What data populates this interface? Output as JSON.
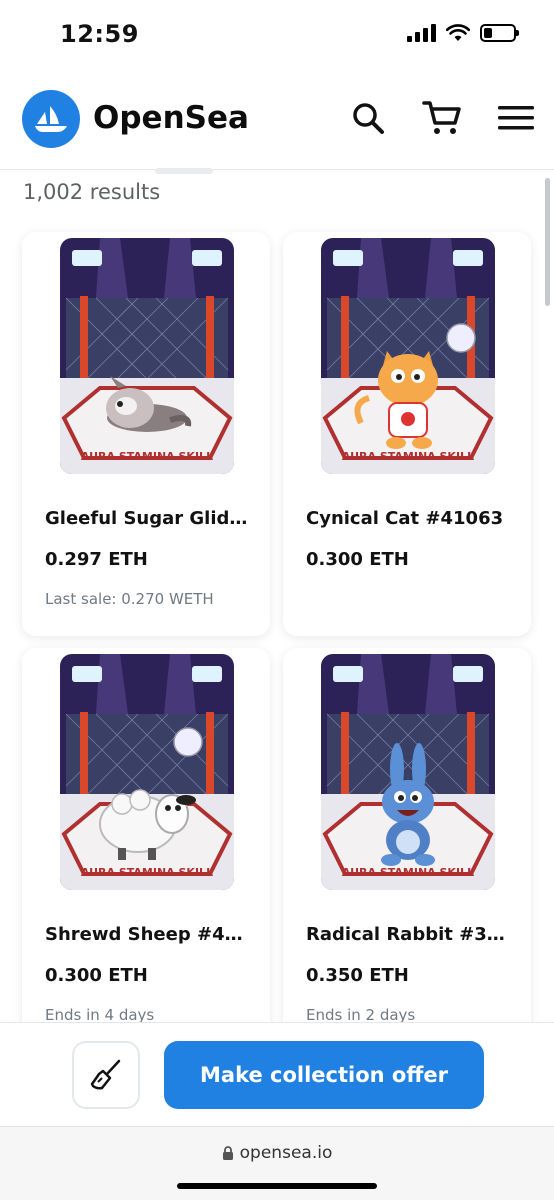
{
  "status_bar": {
    "time": "12:59",
    "battery_level": 0.3
  },
  "header": {
    "brand": "OpenSea",
    "brand_color": "#2081e2",
    "icons": [
      "opensea-logo-icon",
      "search-icon",
      "cart-icon",
      "menu-icon"
    ]
  },
  "results": {
    "count_text": "1,002 results"
  },
  "cards": [
    {
      "name": "Gleeful Sugar Glid…",
      "price": "0.297 ETH",
      "subtext": "Last sale: 0.270 WETH",
      "character": "sugar-glider"
    },
    {
      "name": "Cynical Cat #41063",
      "price": "0.300 ETH",
      "subtext": "",
      "character": "cat"
    },
    {
      "name": "Shrewd Sheep #4…",
      "price": "0.300 ETH",
      "subtext": "Ends in 4 days",
      "character": "sheep"
    },
    {
      "name": "Radical Rabbit #3…",
      "price": "0.350 ETH",
      "subtext": "Ends in 2 days",
      "character": "rabbit"
    }
  ],
  "card_art_text": "AURA STAMINA SKILL",
  "bottom_bar": {
    "offer_label": "Make collection offer",
    "sweep_icon": "broom-icon"
  },
  "browser": {
    "url": "opensea.io",
    "lock_icon": "lock-icon"
  }
}
